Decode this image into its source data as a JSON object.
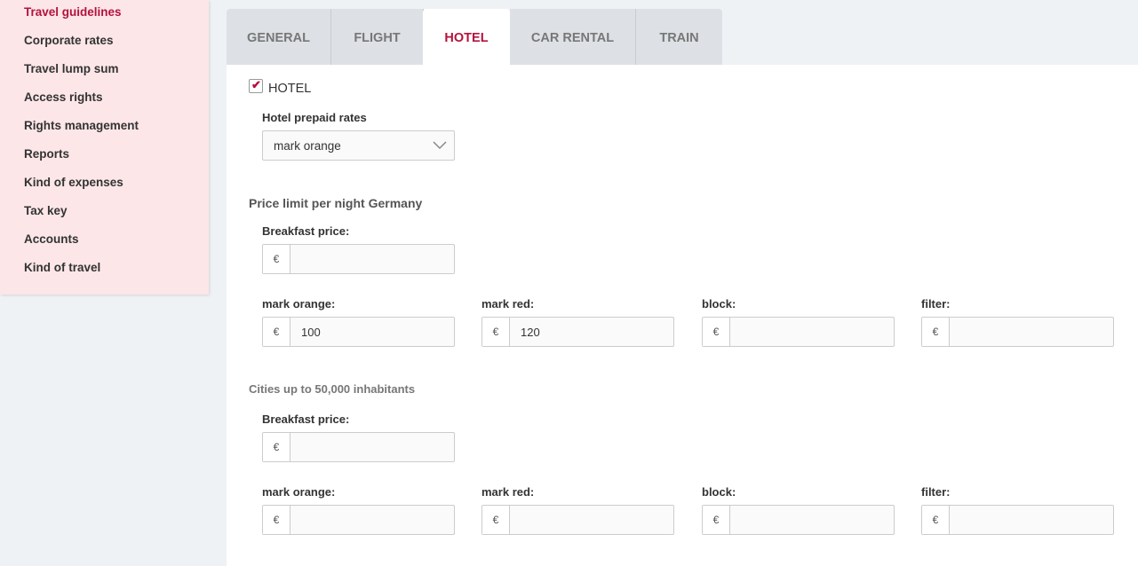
{
  "sidebar": {
    "items": [
      {
        "label": "Travel guidelines"
      },
      {
        "label": "Corporate rates"
      },
      {
        "label": "Travel lump sum"
      },
      {
        "label": "Access rights"
      },
      {
        "label": "Rights management"
      },
      {
        "label": "Reports"
      },
      {
        "label": "Kind of expenses"
      },
      {
        "label": "Tax key"
      },
      {
        "label": "Accounts"
      },
      {
        "label": "Kind of travel"
      }
    ],
    "active_index": 0
  },
  "tabs": [
    {
      "label": "GENERAL"
    },
    {
      "label": "FLIGHT"
    },
    {
      "label": "HOTEL"
    },
    {
      "label": "CAR RENTAL"
    },
    {
      "label": "TRAIN"
    }
  ],
  "active_tab": "HOTEL",
  "hotel": {
    "checkbox_label": "HOTEL",
    "checked": true,
    "prepaid_label": "Hotel prepaid rates",
    "prepaid_value": "mark orange"
  },
  "currency_symbol": "€",
  "sections": [
    {
      "title": "Price limit per night Germany",
      "breakfast_label": "Breakfast price:",
      "breakfast_value": "",
      "fields": [
        {
          "label": "mark orange:",
          "value": "100"
        },
        {
          "label": "mark red:",
          "value": "120"
        },
        {
          "label": "block:",
          "value": ""
        },
        {
          "label": "filter:",
          "value": ""
        }
      ]
    },
    {
      "title": "Cities up to 50,000 inhabitants",
      "breakfast_label": "Breakfast price:",
      "breakfast_value": "",
      "fields": [
        {
          "label": "mark orange:",
          "value": ""
        },
        {
          "label": "mark red:",
          "value": ""
        },
        {
          "label": "block:",
          "value": ""
        },
        {
          "label": "filter:",
          "value": ""
        }
      ]
    }
  ],
  "colors": {
    "accent": "#b3123e",
    "sidebar_bg": "#fce6e8",
    "tab_bg": "#dde1e5"
  }
}
